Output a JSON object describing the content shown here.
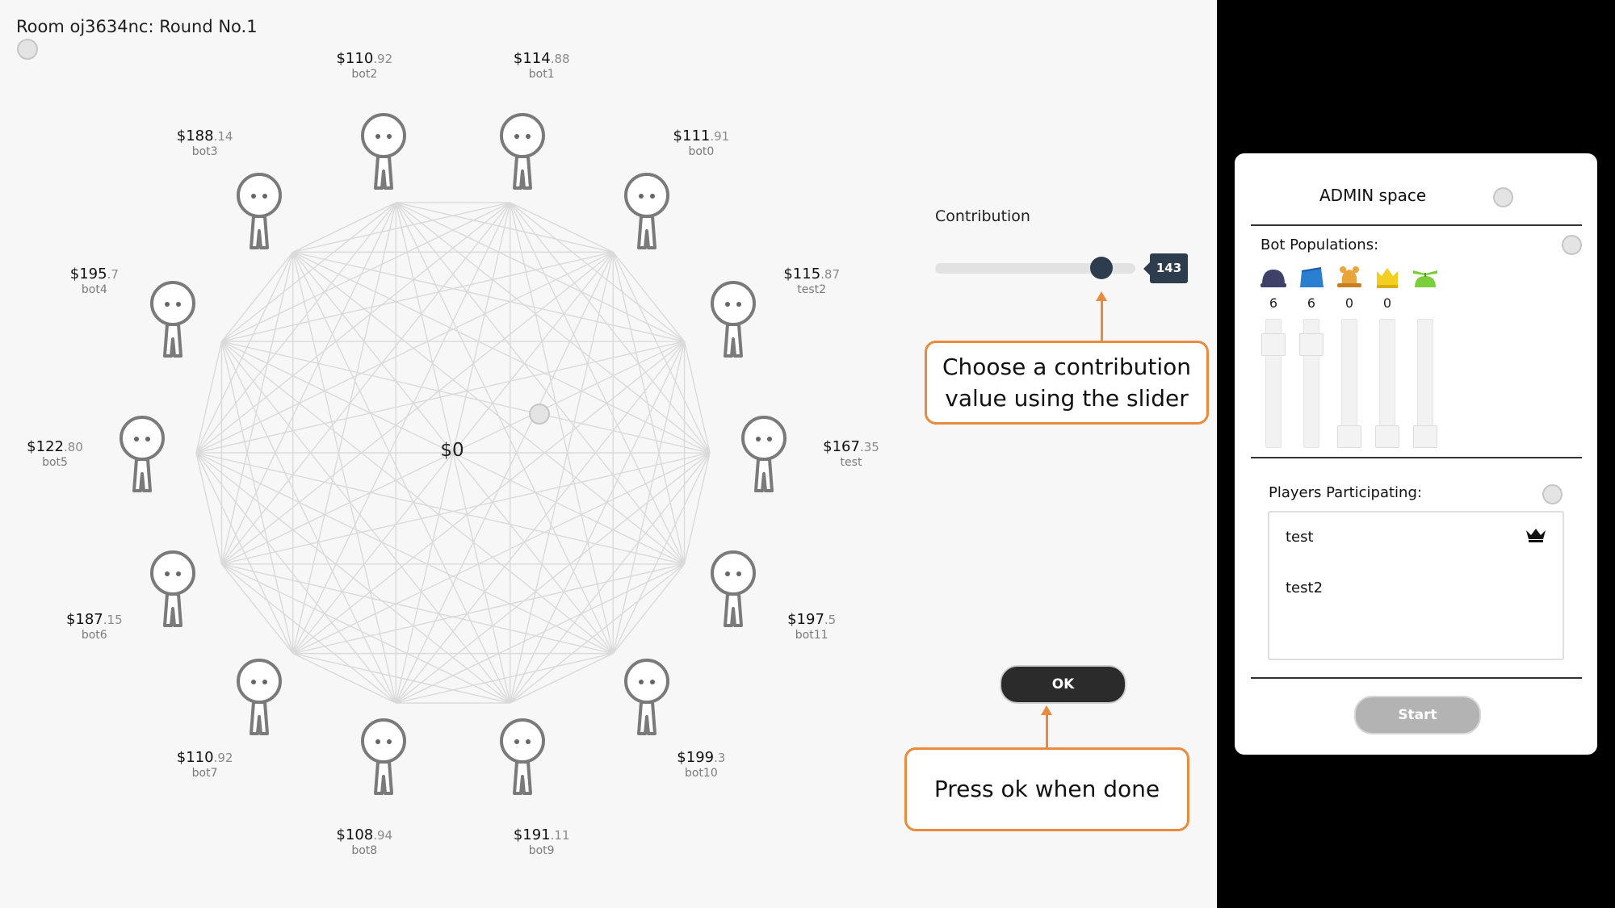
{
  "room": {
    "title": "Room oj3634nc: Round No.1"
  },
  "pot": "$0",
  "players": [
    {
      "id": "bot1",
      "money": "$114",
      "cents": ".88"
    },
    {
      "id": "bot0",
      "money": "$111",
      "cents": ".91"
    },
    {
      "id": "test2",
      "money": "$115",
      "cents": ".87"
    },
    {
      "id": "test",
      "money": "$167",
      "cents": ".35"
    },
    {
      "id": "bot11",
      "money": "$197",
      "cents": ".5"
    },
    {
      "id": "bot10",
      "money": "$199",
      "cents": ".3"
    },
    {
      "id": "bot9",
      "money": "$191",
      "cents": ".11"
    },
    {
      "id": "bot8",
      "money": "$108",
      "cents": ".94"
    },
    {
      "id": "bot7",
      "money": "$110",
      "cents": ".92"
    },
    {
      "id": "bot6",
      "money": "$187",
      "cents": ".15"
    },
    {
      "id": "bot5",
      "money": "$122",
      "cents": ".80"
    },
    {
      "id": "bot4",
      "money": "$195",
      "cents": ".7"
    },
    {
      "id": "bot3",
      "money": "$188",
      "cents": ".14"
    },
    {
      "id": "bot2",
      "money": "$110",
      "cents": ".92"
    }
  ],
  "contribution": {
    "label": "Contribution",
    "value": "143",
    "value_fraction": 0.83
  },
  "callouts": {
    "slider": "Choose a contribution value using the slider",
    "ok": "Press ok when done"
  },
  "ok_button": "OK",
  "admin": {
    "title": "ADMIN space",
    "bots_title": "Bot Populations:",
    "bots": [
      {
        "icon": "blue-cap-hat-icon",
        "count": "6",
        "color": "#3e4268",
        "level": 0.14
      },
      {
        "icon": "blue-fez-hat-icon",
        "count": "6",
        "color": "#2b7fd0",
        "level": 0.14
      },
      {
        "icon": "bell-hat-icon",
        "count": "0",
        "color": "#e9a53a",
        "level": 1.0
      },
      {
        "icon": "yellow-crown-hat-icon",
        "count": "0",
        "color": "#f3cf21",
        "level": 1.0
      },
      {
        "icon": "propeller-hat-icon",
        "count": "",
        "color": "#7bcf3a",
        "level": 1.0
      }
    ],
    "players_title": "Players Participating:",
    "participants": [
      "test",
      "test2"
    ],
    "start_button": "Start"
  },
  "colors": {
    "accent_orange": "#ea8a3c",
    "slider_dark": "#2d3d4d",
    "button_dark": "#2b2b2b",
    "button_disabled": "#b3b3b3"
  }
}
